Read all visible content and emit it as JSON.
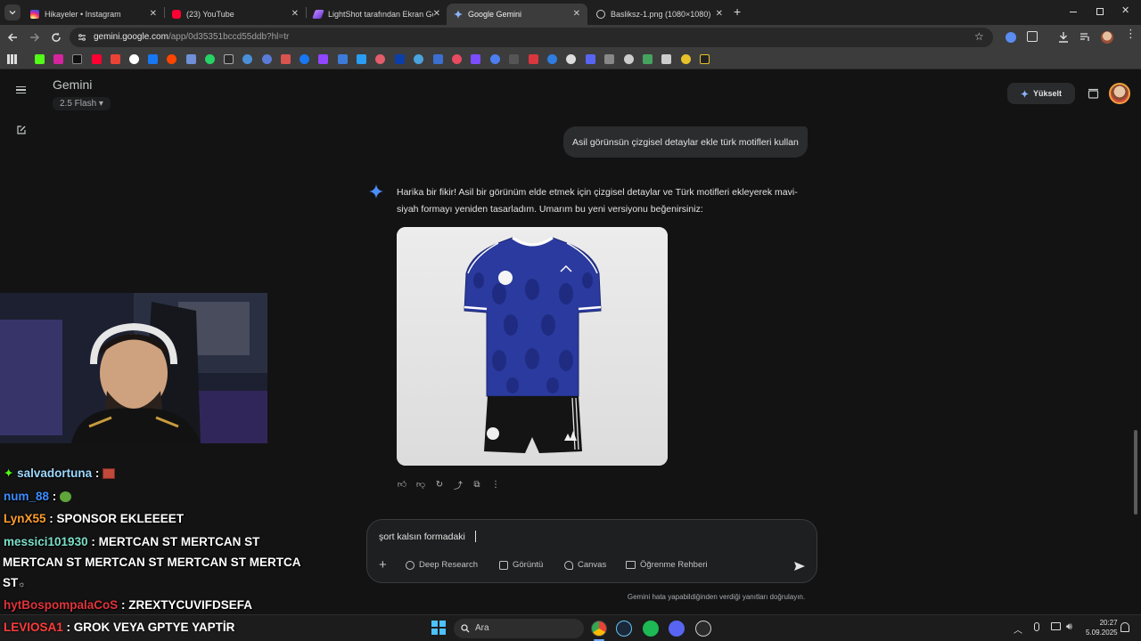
{
  "browser": {
    "tabs": [
      {
        "title": "Hikayeler • Instagram",
        "favicon": "instagram-icon",
        "color": "#d6249f",
        "active": false
      },
      {
        "title": "(23) YouTube",
        "favicon": "youtube-icon",
        "color": "#ff0033",
        "active": false
      },
      {
        "title": "LightShot tarafından Ekran Gö",
        "favicon": "lightshot-icon",
        "color": "#a86bff",
        "active": false
      },
      {
        "title": "Google Gemini",
        "favicon": "gemini-icon",
        "color": "#6ea8ff",
        "active": true
      },
      {
        "title": "Basliksz-1.png (1080×1080)",
        "favicon": "globe-icon",
        "color": "#bdbdbd",
        "active": false
      }
    ],
    "url_host": "gemini.google.com",
    "url_path": "/app/0d35351bccd55ddb?hl=tr"
  },
  "gemini": {
    "brand": "Gemini",
    "model": "2.5 Flash",
    "upgrade_label": "Yükselt",
    "user_message": "Asil görünsün çizgisel detaylar ekle türk motifleri kullan",
    "response_text": "Harika bir fikir! Asil bir görünüm elde etmek için çizgisel detaylar ve Türk motifleri ekleyerek mavi-siyah formayı yeniden tasarladım. Umarım bu yeni versiyonu beğenirsiniz:",
    "input_text": "şort kalsın formadaki",
    "tools": [
      {
        "label": "Deep Research",
        "icon": "deep-research-icon"
      },
      {
        "label": "Görüntü",
        "icon": "image-icon"
      },
      {
        "label": "Canvas",
        "icon": "canvas-icon"
      },
      {
        "label": "Öğrenme Rehberi",
        "icon": "book-icon"
      }
    ],
    "disclaimer": "Gemini hata yapabildiğinden verdiği yanıtları doğrulayın.",
    "accent": "#4c8df6"
  },
  "stream_chat": [
    {
      "user": "salvadortuna",
      "message": "",
      "color": "#9dd7ff",
      "badge": "sparkle-badge-icon",
      "emote": "brick-emote"
    },
    {
      "user": "num_88",
      "message": "",
      "color": "#3b8cff",
      "emote": "frog-emote"
    },
    {
      "user": "LynX55",
      "message": "SPONSOR EKLEEEET",
      "color": "#ff9e2c"
    },
    {
      "user": "messici101930",
      "message": "MERTCAN ST MERTCAN ST",
      "color": "#7be0c8"
    },
    {
      "user": "",
      "message": "MERTCAN ST MERTCAN ST MERTCAN ST MERTCA",
      "color": "#ffffff"
    },
    {
      "user": "",
      "message": "ST",
      "color": "#ffffff"
    },
    {
      "user": "hytBospompalaCoS",
      "message": "ZREXTYCUVIFDSEFA",
      "color": "#e0343b"
    },
    {
      "user": "LEVIOSA1",
      "message": "GROK VEYA GPTYE YAPTİR",
      "color": "#ff3b3b"
    }
  ],
  "taskbar": {
    "search_placeholder": "Ara",
    "time": "20:27",
    "date": "5.09.2025"
  }
}
